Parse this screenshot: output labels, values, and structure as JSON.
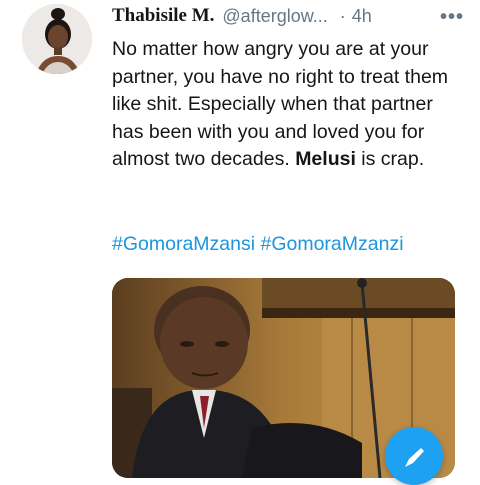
{
  "tweet": {
    "author_name": "Thabisile M.",
    "handle": "@afterglow...",
    "separator": "·",
    "time": "4h",
    "more_label": "•••",
    "text_parts": [
      "No matter how angry you are at your partner, you have no right to treat them like shit. Especially when that partner has been with you and loved you for almost two decades. ",
      "Melusi",
      " is crap."
    ],
    "hashtags": [
      "#GomoraMzansi",
      "#GomoraMzanzi"
    ]
  },
  "icons": {
    "avatar": "profile-photo",
    "media": "photo-man-seated-in-parliament",
    "compose": "compose-tweet-feather-icon"
  },
  "colors": {
    "link": "#1b95e0",
    "muted": "#657786",
    "fab": "#1da1f2"
  }
}
